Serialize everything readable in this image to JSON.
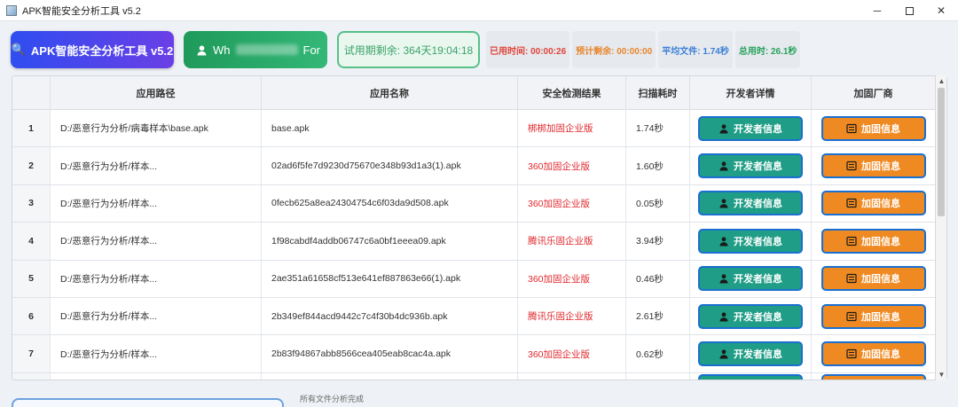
{
  "window": {
    "title": "APK智能安全分析工具 v5.2",
    "controls": {
      "minimize": "─",
      "close": "✕"
    }
  },
  "toolbar": {
    "title_button": "APK智能安全分析工具 v5.2",
    "title_icon": "🔍",
    "user_prefix": "Wh",
    "user_suffix": "For",
    "trial": "试用期剩余: 364天19:04:18"
  },
  "stats": {
    "used": "已用时间: 00:00:26",
    "remaining": "预计剩余: 00:00:00",
    "avg": "平均文件: 1.74秒",
    "total": "总用时: 26.1秒"
  },
  "table": {
    "headers": [
      "",
      "应用路径",
      "应用名称",
      "安全检测结果",
      "扫描耗时",
      "开发者详情",
      "加固厂商"
    ],
    "dev_button": "开发者信息",
    "pack_button": "加固信息",
    "rows": [
      {
        "index": "1",
        "path": "D:/恶意行为分析/病毒样本\\base.apk",
        "name": "base.apk",
        "result": "梆梆加固企业版",
        "time": "1.74秒"
      },
      {
        "index": "2",
        "path": "D:/恶意行为分析/样本...",
        "name": "02ad6f5fe7d9230d75670e348b93d1a3(1).apk",
        "result": "360加固企业版",
        "time": "1.60秒"
      },
      {
        "index": "3",
        "path": "D:/恶意行为分析/样本...",
        "name": "0fecb625a8ea24304754c6f03da9d508.apk",
        "result": "360加固企业版",
        "time": "0.05秒"
      },
      {
        "index": "4",
        "path": "D:/恶意行为分析/样本...",
        "name": "1f98cabdf4addb06747c6a0bf1eeea09.apk",
        "result": "腾讯乐固企业版",
        "time": "3.94秒"
      },
      {
        "index": "5",
        "path": "D:/恶意行为分析/样本...",
        "name": "2ae351a61658cf513e641ef887863e66(1).apk",
        "result": "360加固企业版",
        "time": "0.46秒"
      },
      {
        "index": "6",
        "path": "D:/恶意行为分析/样本...",
        "name": "2b349ef844acd9442c7c4f30b4dc936b.apk",
        "result": "腾讯乐固企业版",
        "time": "2.61秒"
      },
      {
        "index": "7",
        "path": "D:/恶意行为分析/样本...",
        "name": "2b83f94867abb8566cea405eab8cac4a.apk",
        "result": "360加固企业版",
        "time": "0.62秒"
      }
    ]
  },
  "status": {
    "text": "所有文件分析完成"
  }
}
